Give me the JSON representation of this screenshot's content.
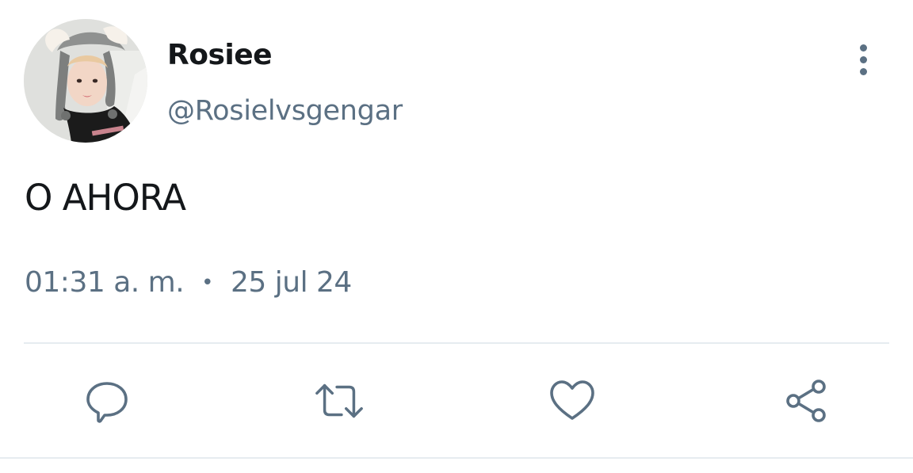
{
  "tweet": {
    "author": {
      "display_name": "Rosiee",
      "handle": "@Rosielvsgengar",
      "avatar_icon": "profile-photo"
    },
    "text": "O AHORA",
    "time": "01:31 a. m.",
    "separator": "•",
    "date": "25 jul 24"
  },
  "actions": {
    "reply_icon": "reply-icon",
    "retweet_icon": "retweet-icon",
    "like_icon": "heart-icon",
    "share_icon": "share-icon",
    "more_icon": "more-vertical-icon"
  },
  "colors": {
    "primary_text": "#14171a",
    "secondary_text": "#5b7083",
    "divider": "#e6ecf0"
  }
}
